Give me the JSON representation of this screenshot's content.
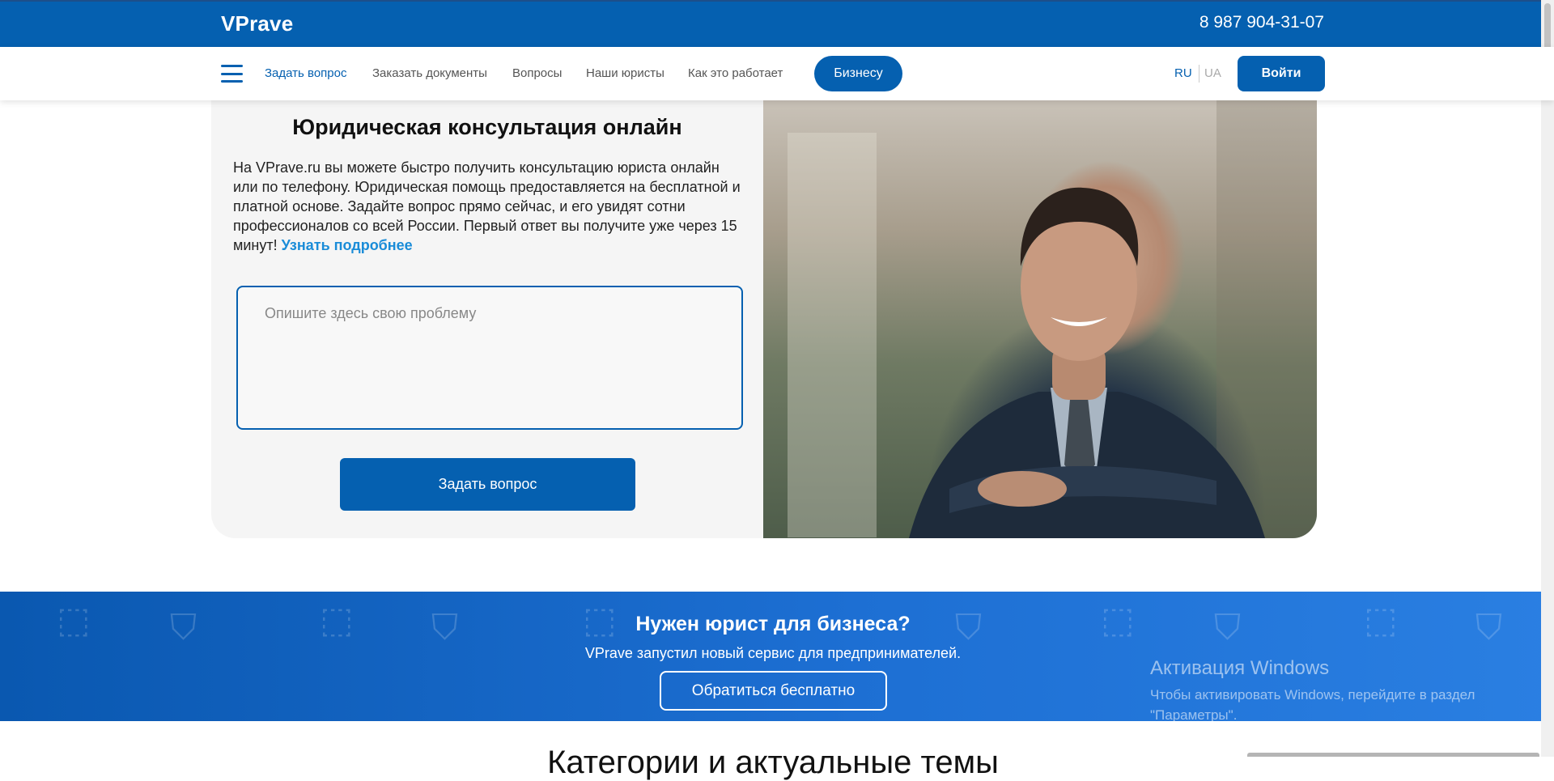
{
  "header": {
    "logo": "VPrave",
    "phone": "8 987 904-31-07"
  },
  "nav": {
    "items": [
      {
        "label": "Задать вопрос"
      },
      {
        "label": "Заказать документы"
      },
      {
        "label": "Вопросы"
      },
      {
        "label": "Наши юристы"
      },
      {
        "label": "Как это работает"
      }
    ],
    "business_button": "Бизнесу",
    "lang_ru": "RU",
    "lang_ua": "UA",
    "login_button": "Войти"
  },
  "hero": {
    "title": "Юридическая консультация онлайн",
    "text": "На VPrave.ru вы можете быстро получить консультацию юриста онлайн или по телефону. Юридическая помощь предоставляется на бесплатной и платной основе. Задайте вопрос прямо сейчас, и его увидят сотни профессионалов со всей России. Первый ответ вы получите уже через 15 минут! ",
    "link": "Узнать подробнее",
    "placeholder": "Опишите здесь свою проблему",
    "ask_button": "Задать вопрос"
  },
  "business_band": {
    "title": "Нужен юрист для бизнеса?",
    "subtitle": "VPrave запустил новый сервис для предпринимателей.",
    "button": "Обратиться бесплатно"
  },
  "windows_watermark": {
    "title": "Активация Windows",
    "text_line1": "Чтобы активировать Windows, перейдите в раздел",
    "text_line2": "\"Параметры\"."
  },
  "next_section": {
    "heading": "Категории и актуальные темы"
  },
  "colors": {
    "brand": "#0560b0",
    "link": "#1a8cd8",
    "band": "#1d6fd3"
  }
}
